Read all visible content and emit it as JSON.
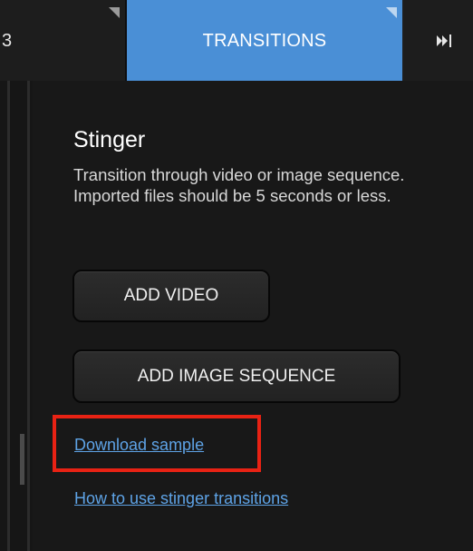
{
  "tabs": {
    "previous_label": "3",
    "active_label": "TRANSITIONS"
  },
  "stinger": {
    "title": "Stinger",
    "description": "Transition through video or image sequence. Imported files should be 5 seconds or less.",
    "add_video_label": "ADD VIDEO",
    "add_image_sequence_label": "ADD IMAGE SEQUENCE",
    "download_sample_link": "Download sample",
    "how_to_link": "How to use stinger transitions"
  },
  "colors": {
    "active_tab": "#4a8fd6",
    "link": "#5ea3e6",
    "highlight_box": "#e82214"
  },
  "icons": {
    "next_tab": "skip-forward-icon"
  }
}
